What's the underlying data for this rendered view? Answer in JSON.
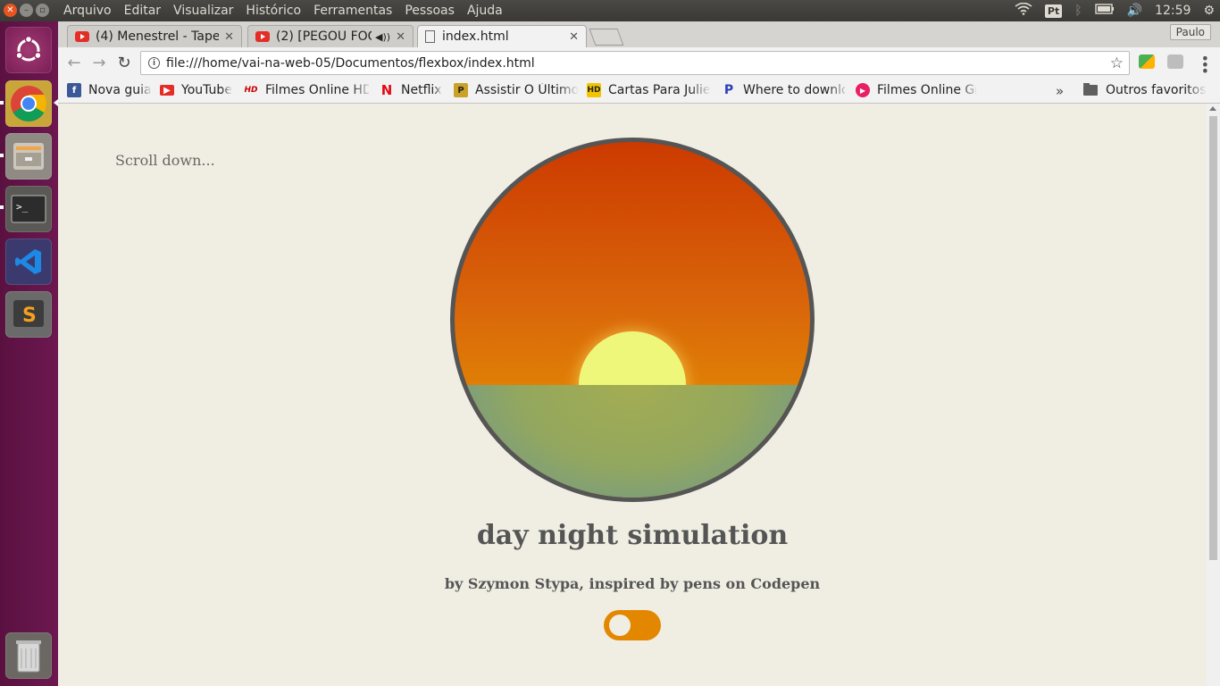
{
  "system": {
    "menu": [
      "Arquivo",
      "Editar",
      "Visualizar",
      "Histórico",
      "Ferramentas",
      "Pessoas",
      "Ajuda"
    ],
    "keyboard": "Pt",
    "clock": "12:59"
  },
  "browser": {
    "tabs": [
      {
        "title": "(4) Menestrel - Tape"
      },
      {
        "title": "(2) [PEGOU FOGO"
      },
      {
        "title": "index.html"
      }
    ],
    "profile": "Paulo",
    "url": "file:///home/vai-na-web-05/Documentos/flexbox/index.html",
    "bookmarks": [
      {
        "label": "Nova guia",
        "icon": "facebook-icon"
      },
      {
        "label": "YouTube",
        "icon": "youtube-icon"
      },
      {
        "label": "Filmes Online HD",
        "icon": "hd-icon"
      },
      {
        "label": "Netflix",
        "icon": "netflix-icon"
      },
      {
        "label": "Assistir O Último",
        "icon": "p-icon"
      },
      {
        "label": "Cartas Para Julie",
        "icon": "hd-icon"
      },
      {
        "label": "Where to downlo",
        "icon": "p-icon"
      },
      {
        "label": "Filmes Online Gr",
        "icon": "play-icon"
      }
    ],
    "other_bookmarks": "Outros favoritos"
  },
  "page": {
    "scroll_hint": "Scroll down...",
    "title": "day night simulation",
    "byline": "by Szymon Stypa, inspired by pens on Codepen",
    "toggle_on": false
  },
  "colors": {
    "background": "#f0eee3",
    "sky_top": "#cc3a00",
    "sky_bottom": "#e9a000",
    "sun": "#eff77a",
    "toggle": "#e38700",
    "text": "#555555"
  }
}
